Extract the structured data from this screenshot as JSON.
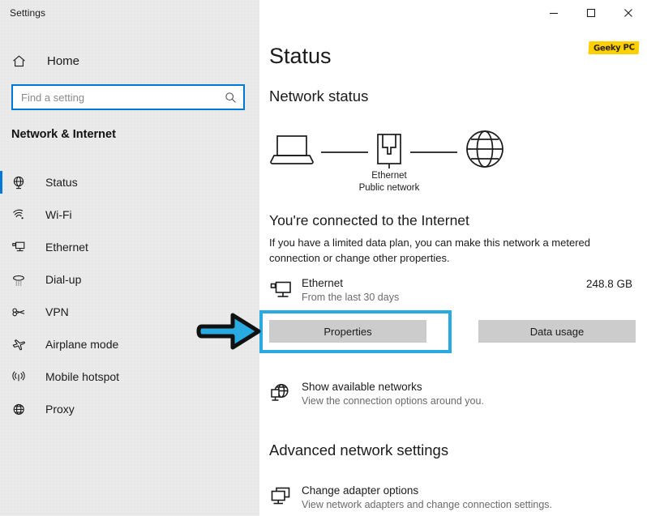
{
  "window": {
    "title": "Settings",
    "controls": {
      "minimize": "minimize-button",
      "maximize": "maximize-button",
      "close": "close-button"
    }
  },
  "sidebar": {
    "home_label": "Home",
    "search": {
      "placeholder": "Find a setting",
      "value": ""
    },
    "section_title": "Network & Internet",
    "items": [
      {
        "label": "Status",
        "icon": "status-globe-icon",
        "selected": true
      },
      {
        "label": "Wi-Fi",
        "icon": "wifi-icon",
        "selected": false
      },
      {
        "label": "Ethernet",
        "icon": "ethernet-icon",
        "selected": false
      },
      {
        "label": "Dial-up",
        "icon": "dialup-phone-icon",
        "selected": false
      },
      {
        "label": "VPN",
        "icon": "vpn-key-icon",
        "selected": false
      },
      {
        "label": "Airplane mode",
        "icon": "airplane-icon",
        "selected": false
      },
      {
        "label": "Mobile hotspot",
        "icon": "hotspot-antenna-icon",
        "selected": false
      },
      {
        "label": "Proxy",
        "icon": "proxy-globe-icon",
        "selected": false
      }
    ]
  },
  "main": {
    "page_title": "Status",
    "watermark": "Geeky PC",
    "network_status_heading": "Network status",
    "diagram": {
      "device_icon": "laptop-icon",
      "middle_icon": "ethernet-port-icon",
      "internet_icon": "globe-icon",
      "label_line1": "Ethernet",
      "label_line2": "Public network"
    },
    "connected_title": "You're connected to the Internet",
    "connected_desc": "If you have a limited data plan, you can make this network a metered connection or change other properties.",
    "adapter": {
      "icon": "ethernet-monitor-icon",
      "name": "Ethernet",
      "subtitle": "From the last 30 days",
      "usage": "248.8 GB"
    },
    "buttons": {
      "properties": "Properties",
      "data_usage": "Data usage"
    },
    "show_networks": {
      "icon": "globe-monitor-icon",
      "title": "Show available networks",
      "subtitle": "View the connection options around you."
    },
    "advanced_heading": "Advanced network settings",
    "change_adapter": {
      "icon": "adapter-monitor-icon",
      "title": "Change adapter options",
      "subtitle": "View network adapters and change connection settings."
    }
  },
  "annotations": {
    "arrow": "pointer-arrow-right",
    "highlight_target": "Properties",
    "accent_color": "#29abe2",
    "brand_color": "#0078d7",
    "highlight_marker_color": "#ffd000"
  }
}
